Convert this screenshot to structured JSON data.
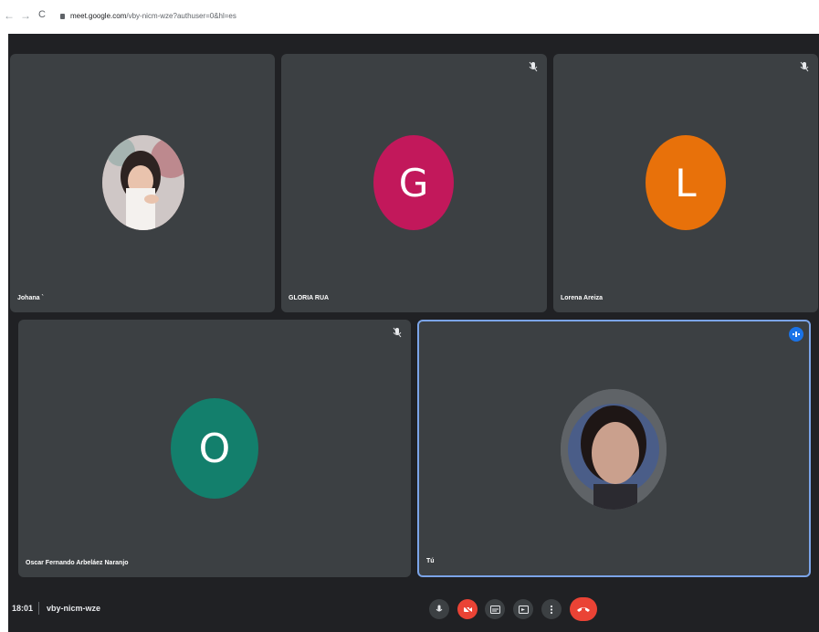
{
  "browser": {
    "url_host": "meet.google.com",
    "url_path": "/vby-nicm-wze?authuser=0&hl=es"
  },
  "participants": [
    {
      "name": "Johana `",
      "kind": "photo",
      "muted": false
    },
    {
      "name": "GLORIA RUA",
      "kind": "initial",
      "initial": "G",
      "color": "#c2185b",
      "muted": true
    },
    {
      "name": "Lorena Areiza",
      "kind": "initial",
      "initial": "L",
      "color": "#e8710a",
      "muted": true
    },
    {
      "name": "Oscar Fernando Arbeláez Naranjo",
      "kind": "initial",
      "initial": "O",
      "color": "#137f6c",
      "muted": true
    },
    {
      "name": "Tú",
      "kind": "photo",
      "muted": false,
      "speaking": true
    }
  ],
  "bottom_bar": {
    "time": "18:01",
    "meeting_code": "vby-nicm-wze"
  },
  "colors": {
    "background": "#202124",
    "tile": "#3c4043",
    "accent": "#1a73e8",
    "danger": "#ea4335"
  }
}
